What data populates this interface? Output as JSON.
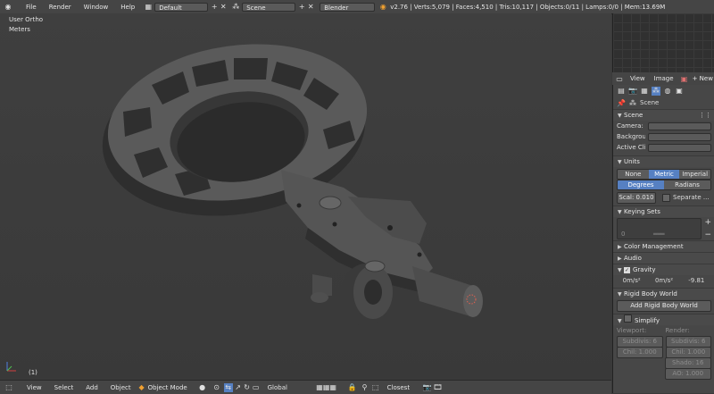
{
  "top": {
    "menus": [
      "File",
      "Render",
      "Window",
      "Help"
    ],
    "layout": "Default",
    "scene": "Scene",
    "engine": "Blender Render",
    "stats": "v2.76 | Verts:5,079 | Faces:4,510 | Tris:10,117 | Objects:0/11 | Lamps:0/0 | Mem:13.69M"
  },
  "viewport": {
    "view_name": "User Ortho",
    "units": "Meters",
    "frame": "(1)"
  },
  "bottom": {
    "menus": [
      "View",
      "Select",
      "Add",
      "Object"
    ],
    "mode": "Object Mode",
    "orientation": "Global",
    "snap": "Closest"
  },
  "image_editor": {
    "menus": [
      "View",
      "Image"
    ],
    "new_label": "New"
  },
  "props": {
    "scene_label": "Scene",
    "panel_scene": "Scene",
    "camera_label": "Camera:",
    "background_label": "Backgrou",
    "active_clip_label": "Active Cli",
    "panel_units": "Units",
    "unit_none": "None",
    "unit_metric": "Metric",
    "unit_imperial": "Imperial",
    "rot_degrees": "Degrees",
    "rot_radians": "Radians",
    "scale_field": "Scal: 0.010",
    "separate": "Separate ...",
    "panel_keying": "Keying Sets",
    "keying_zero": "0",
    "panel_color": "Color Management",
    "panel_audio": "Audio",
    "panel_gravity": "Gravity",
    "grav_x": "0m/s²",
    "grav_y": "0m/s²",
    "grav_z": "-9.81",
    "panel_rigid": "Rigid Body World",
    "add_rigid": "Add Rigid Body World",
    "panel_simplify": "Simplify",
    "viewport_label": "Viewport:",
    "render_label": "Render:",
    "subdiv_v": "Subdivis: 6",
    "subdiv_r": "Subdivis: 6",
    "child_v": "Chil: 1.000",
    "child_r": "Chil: 1.000",
    "shadow_r": "Shado: 16",
    "ao_r": "AO: 1.000"
  }
}
